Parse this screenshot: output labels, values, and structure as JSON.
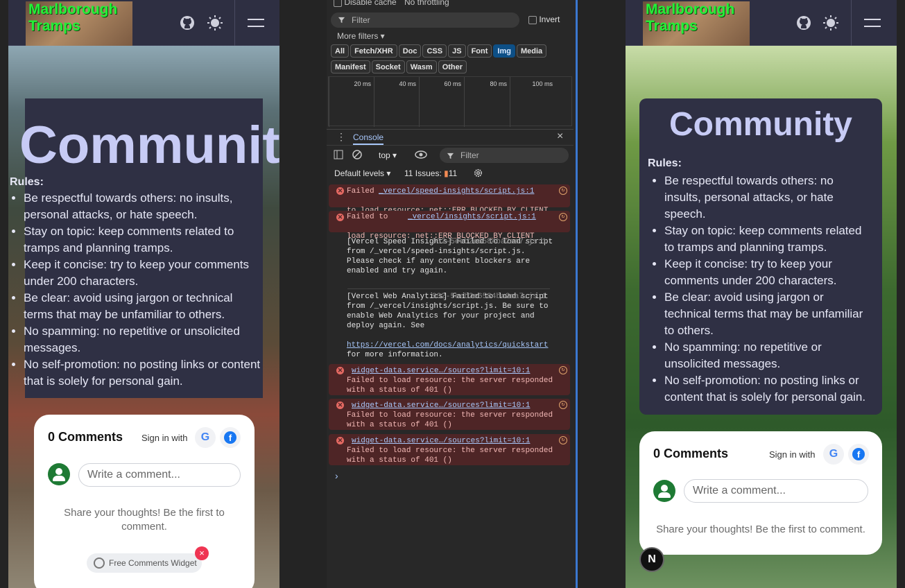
{
  "site": {
    "logo_line1": "Marlborough",
    "logo_line2": "Tramps",
    "page_title": "Community",
    "rules_heading": "Rules:",
    "rules": [
      "Be respectful towards others: no insults, personal attacks, or hate speech.",
      "Stay on topic: keep comments related to tramps and planning tramps.",
      "Keep it concise: try to keep your comments under 200 characters.",
      "Be clear: avoid using jargon or technical terms that may be unfamiliar to others.",
      "No spamming: no repetitive or unsolicited messages.",
      "No self-promotion: no posting links or content that is solely for personal gain."
    ],
    "left_rules": [
      "Be respectful towards others: no insults, personal attacks, or hate speech.",
      "Stay on topic: keep comments related to tramps and planning tramps.",
      "Keep it concise: try to keep your comments under 200 characters.",
      "Be clear: avoid using jargon or technical terms that may be unfamiliar to others.",
      "No spamming: no repetitive or unsolicited messages.",
      "No self-promotion: no posting links or content that is solely for personal gain."
    ],
    "comments": {
      "count_label": "0 Comments",
      "sign_in": "Sign in with",
      "google": "G",
      "facebook": "f",
      "placeholder": "Write a comment...",
      "empty": "Share your thoughts! Be the first to comment.",
      "widget": "Free Comments Widget",
      "close": "×"
    },
    "next_badge": "N"
  },
  "devtools": {
    "disable_cache": "Disable cache",
    "throttling": "No throttling",
    "filter_placeholder": "Filter",
    "invert": "Invert",
    "more_filters": "More filters",
    "chips": [
      "All",
      "Fetch/XHR",
      "Doc",
      "CSS",
      "JS",
      "Font",
      "Img",
      "Media",
      "Manifest",
      "Socket",
      "Wasm",
      "Other"
    ],
    "selected_chip": "Img",
    "ticks": [
      "20 ms",
      "40 ms",
      "60 ms",
      "80 ms",
      "100 ms"
    ],
    "console_tab": "Console",
    "context": "top",
    "console_filter": "Filter",
    "levels": "Default levels",
    "issues_label": "11 Issues:",
    "issues_count": "11",
    "messages": [
      {
        "type": "error",
        "link": "_vercel/speed-insights/script.js:1",
        "text": "Failed\n\nto load resource: net::ERR_BLOCKED_BY_CLIENT"
      },
      {
        "type": "error",
        "link": "_vercel/insights/script.js:1",
        "text": "Failed to\n\nload resource: net::ERR_BLOCKED_BY_CLIENT"
      },
      {
        "type": "info",
        "source": "932-5eeb2e6584ba2aa7.js:1",
        "text": "[Vercel Speed Insights] Failed to load script from /_vercel/speed-insights/script.js. Please check if any content blockers are enabled and try again."
      },
      {
        "type": "info",
        "source": "932-5eeb2e6584ba2aa7.js:1",
        "text": "[Vercel Web Analytics] Failed to load script from /_vercel/insights/script.js. Be sure to enable Web Analytics for your project and deploy again. See",
        "link": "https://vercel.com/docs/analytics/quickstart",
        "tail": "for more information."
      },
      {
        "type": "error",
        "link": "widget-data.service…/sources?limit=10:1",
        "text": "Failed to load resource: the server responded with a status of 401 ()"
      },
      {
        "type": "error",
        "link": "widget-data.service…/sources?limit=10:1",
        "text": "Failed to load resource: the server responded with a status of 401 ()"
      },
      {
        "type": "error",
        "link": "widget-data.service…/sources?limit=10:1",
        "text": "Failed to load resource: the server responded with a status of 401 ()"
      }
    ],
    "prompt": "›"
  }
}
